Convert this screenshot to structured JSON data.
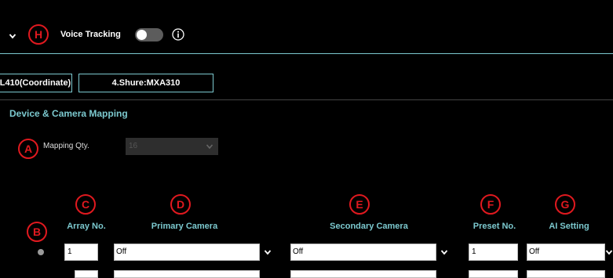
{
  "header": {
    "voice_tracking_label": "Voice Tracking",
    "voice_tracking_on": false
  },
  "badges": {
    "h": "H",
    "a": "A",
    "b": "B",
    "c": "C",
    "d": "D",
    "e": "E",
    "f": "F",
    "g": "G"
  },
  "tabs": [
    {
      "label": "L410(Coordinate)"
    },
    {
      "label": "4.Shure:MXA310"
    }
  ],
  "section": {
    "title": "Device & Camera Mapping"
  },
  "mapping": {
    "label": "Mapping Qty.",
    "value": "16"
  },
  "columns": {
    "array_no": "Array No.",
    "primary_camera": "Primary Camera",
    "secondary_camera": "Secondary Camera",
    "preset_no": "Preset No.",
    "ai_setting": "AI Setting"
  },
  "rows": [
    {
      "array_no": "1",
      "primary": "Off",
      "secondary": "Off",
      "preset": "1",
      "ai": "Off"
    },
    {
      "array_no": "",
      "primary": "",
      "secondary": "",
      "preset": "",
      "ai": ""
    }
  ],
  "colors": {
    "accent": "#7cc9cf",
    "badge": "#e0191f",
    "background": "#000000"
  }
}
